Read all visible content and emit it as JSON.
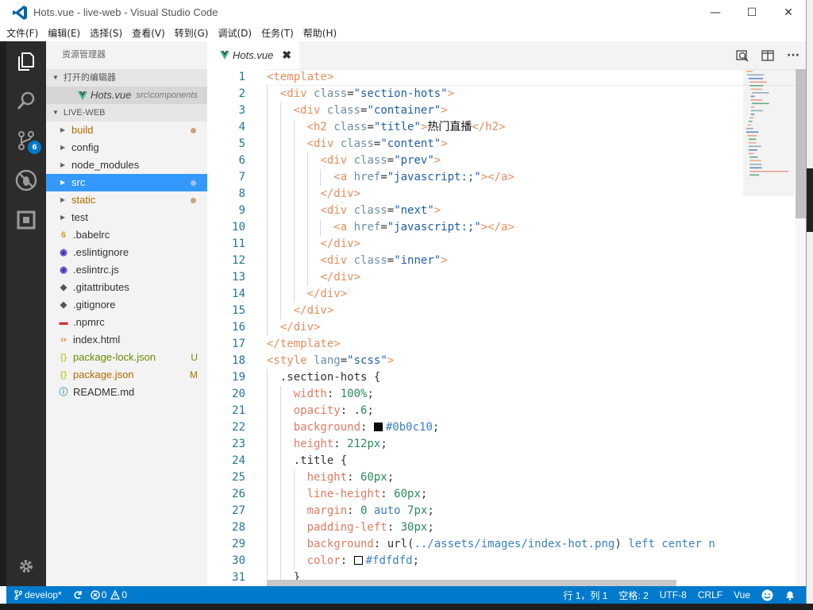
{
  "window": {
    "title": "Hots.vue - live-web - Visual Studio Code",
    "controls": {
      "minimize": "—",
      "maximize": "☐",
      "close": "✕"
    }
  },
  "menu": [
    "文件(F)",
    "编辑(E)",
    "选择(S)",
    "查看(V)",
    "转到(G)",
    "调试(D)",
    "任务(T)",
    "帮助(H)"
  ],
  "activity": {
    "items": [
      "explorer-icon",
      "search-icon",
      "source-control-icon",
      "debug-icon",
      "extensions-icon"
    ],
    "scm_badge": "6",
    "settings": "gear-icon"
  },
  "sidebar": {
    "title": "资源管理器",
    "open_editors_title": "打开的编辑器",
    "open_editor": {
      "name": "Hots.vue",
      "path": "src\\components"
    },
    "project_title": "LIVE-WEB",
    "tree": [
      {
        "name": "build",
        "type": "folder",
        "status": "dot"
      },
      {
        "name": "config",
        "type": "folder",
        "status": ""
      },
      {
        "name": "node_modules",
        "type": "folder",
        "status": ""
      },
      {
        "name": "src",
        "type": "folder",
        "status": "dot",
        "selected": true
      },
      {
        "name": "static",
        "type": "folder",
        "status": "dot"
      },
      {
        "name": "test",
        "type": "folder",
        "status": ""
      },
      {
        "name": ".babelrc",
        "type": "babel",
        "status": ""
      },
      {
        "name": ".eslintignore",
        "type": "eslint",
        "status": ""
      },
      {
        "name": ".eslintrc.js",
        "type": "eslint",
        "status": ""
      },
      {
        "name": ".gitattributes",
        "type": "git",
        "status": ""
      },
      {
        "name": ".gitignore",
        "type": "git",
        "status": ""
      },
      {
        "name": ".npmrc",
        "type": "npm",
        "status": ""
      },
      {
        "name": "index.html",
        "type": "html",
        "status": ""
      },
      {
        "name": "package-lock.json",
        "type": "json",
        "status": "U"
      },
      {
        "name": "package.json",
        "type": "json",
        "status": "M"
      },
      {
        "name": "README.md",
        "type": "info",
        "status": ""
      }
    ]
  },
  "editor": {
    "tab": "Hots.vue",
    "tab_close": "✖",
    "line_numbers": [
      "1",
      "2",
      "3",
      "4",
      "5",
      "6",
      "7",
      "8",
      "9",
      "10",
      "11",
      "12",
      "13",
      "14",
      "15",
      "16",
      "17",
      "18",
      "19",
      "20",
      "21",
      "22",
      "23",
      "24",
      "25",
      "26",
      "27",
      "28",
      "29",
      "30",
      "31"
    ],
    "lines": [
      "<template>",
      "  <div class=\"section-hots\">",
      "    <div class=\"container\">",
      "      <h2 class=\"title\">热门直播</h2>",
      "      <div class=\"content\">",
      "        <div class=\"prev\">",
      "          <a href=\"javascript:;\"></a>",
      "        </div>",
      "        <div class=\"next\">",
      "          <a href=\"javascript:;\"></a>",
      "        </div>",
      "        <div class=\"inner\">",
      "        </div>",
      "      </div>",
      "    </div>",
      "  </div>",
      "</template>",
      "<style lang=\"scss\">",
      "  .section-hots {",
      "    width: 100%;",
      "    opacity: .6;",
      "    background: #0b0c10;",
      "    height: 212px;",
      "    .title {",
      "      height: 60px;",
      "      line-height: 60px;",
      "      margin: 0 auto 7px;",
      "      padding-left: 30px;",
      "      background: url(../assets/images/index-hot.png) left center n",
      "      color: #fdfdfd;",
      "    }"
    ],
    "colors": {
      "background_swatch": "#0b0c10",
      "color_swatch": "#fdfdfd"
    }
  },
  "status": {
    "branch": "develop*",
    "errors": "0",
    "warnings": "0",
    "position": "行 1，列 1",
    "spaces": "空格: 2",
    "encoding": "UTF-8",
    "eol": "CRLF",
    "language": "Vue"
  }
}
